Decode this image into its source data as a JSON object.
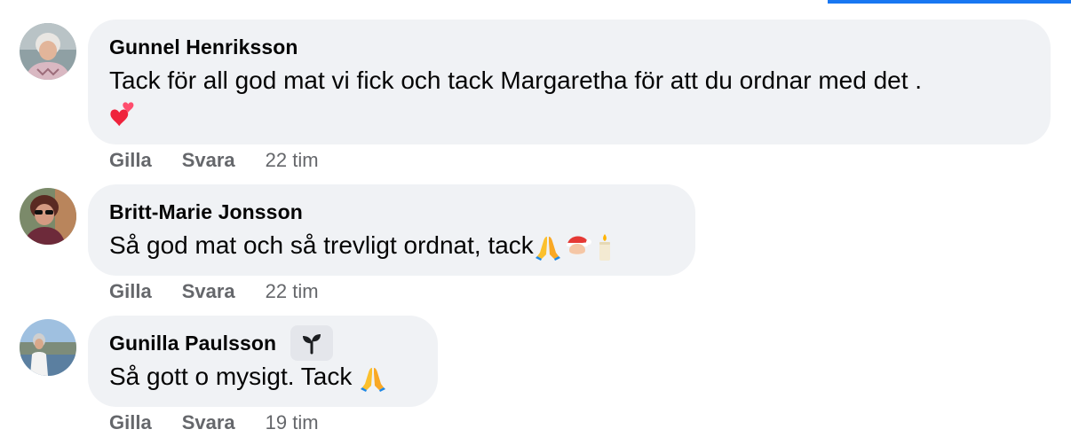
{
  "comments": [
    {
      "author": "Gunnel Henriksson",
      "text": "Tack för all god mat vi fick och tack Margaretha för att du ordnar med det .",
      "emoji_line": "💕",
      "like_label": "Gilla",
      "reply_label": "Svara",
      "time": "22 tim"
    },
    {
      "author": "Britt-Marie Jonsson",
      "text": "Så god mat och så trevligt ordnat, tack",
      "emojis": [
        "🙏",
        "🎅",
        "🕯️"
      ],
      "like_label": "Gilla",
      "reply_label": "Svara",
      "time": "22 tim"
    },
    {
      "author": "Gunilla Paulsson",
      "badge_icon": "sprout-icon",
      "text": "Så gott o mysigt. Tack ",
      "emojis": [
        "🙏"
      ],
      "like_label": "Gilla",
      "reply_label": "Svara",
      "time": "19 tim"
    }
  ],
  "colors": {
    "bubble": "#f0f2f5",
    "meta": "#65676b",
    "accent": "#1877f2"
  }
}
